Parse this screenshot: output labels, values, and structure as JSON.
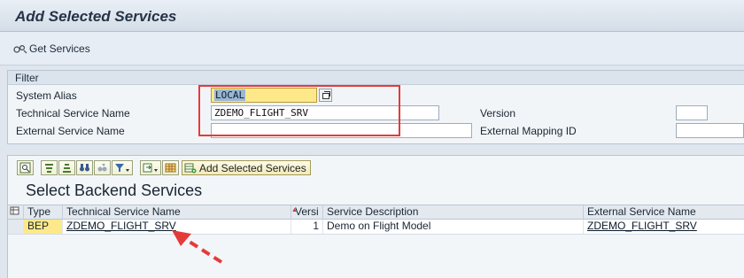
{
  "window": {
    "title": "Add Selected Services"
  },
  "toolbar": {
    "get_services_label": "Get Services"
  },
  "filter": {
    "header": "Filter",
    "system_alias": {
      "label": "System Alias",
      "value": "LOCAL"
    },
    "technical_service_name": {
      "label": "Technical Service Name",
      "value": "ZDEMO_FLIGHT_SRV"
    },
    "external_service_name": {
      "label": "External Service Name",
      "value": ""
    },
    "version": {
      "label": "Version",
      "value": ""
    },
    "external_mapping_id": {
      "label": "External Mapping ID",
      "value": ""
    }
  },
  "results": {
    "add_selected_services_label": "Add Selected Services",
    "section_title": "Select Backend Services",
    "columns": [
      "Type",
      "Technical Service Name",
      "Versi",
      "Service Description",
      "External Service Name"
    ],
    "rows": [
      {
        "type": "BEP",
        "technical_service_name": "ZDEMO_FLIGHT_SRV",
        "version": "1",
        "service_description": "Demo on Flight Model",
        "external_service_name": "ZDEMO_FLIGHT_SRV"
      }
    ]
  },
  "colors": {
    "highlight_box": "#e53a3a",
    "active_field": "#fde98a",
    "arrow": "#e53a3a"
  }
}
